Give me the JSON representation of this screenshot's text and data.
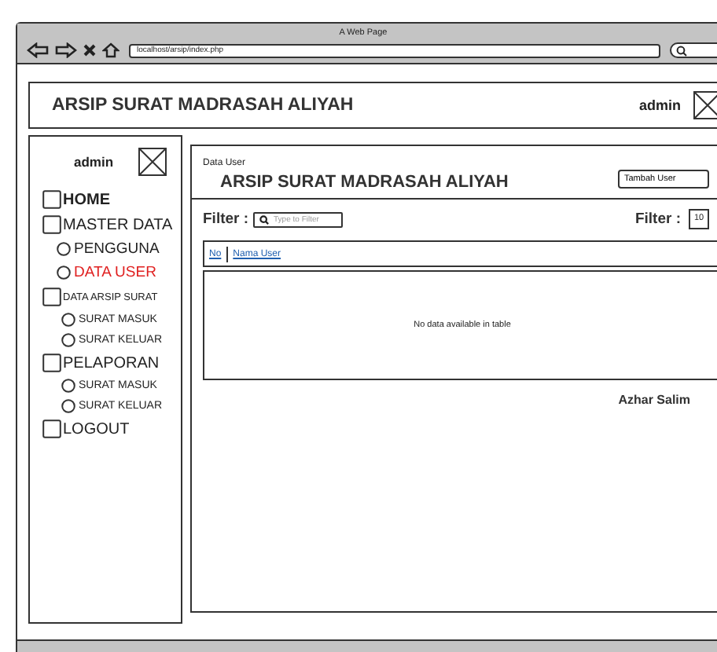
{
  "browser": {
    "title": "A Web Page",
    "url": "localhost/arsip/index.php"
  },
  "header": {
    "title": "ARSIP SURAT MADRASAH ALIYAH",
    "user": "admin"
  },
  "sidebar": {
    "user": "admin",
    "items": [
      {
        "label": "HOME",
        "kind": "square",
        "selected": false
      },
      {
        "label": "MASTER DATA",
        "kind": "square",
        "selected": false,
        "children": [
          {
            "label": "PENGGUNA",
            "kind": "circle",
            "selected": false
          },
          {
            "label": "DATA USER",
            "kind": "circle",
            "selected": true
          }
        ]
      },
      {
        "label": "DATA ARSIP SURAT",
        "kind": "square",
        "selected": false,
        "children": [
          {
            "label": "SURAT MASUK",
            "kind": "circle",
            "selected": false
          },
          {
            "label": "SURAT KELUAR",
            "kind": "circle",
            "selected": false
          }
        ]
      },
      {
        "label": "PELAPORAN",
        "kind": "square",
        "selected": false,
        "children": [
          {
            "label": "SURAT MASUK",
            "kind": "circle",
            "selected": false
          },
          {
            "label": "SURAT KELUAR",
            "kind": "circle",
            "selected": false
          }
        ]
      },
      {
        "label": "LOGOUT",
        "kind": "square",
        "selected": false
      }
    ]
  },
  "main": {
    "breadcrumb": "Data User",
    "title": "ARSIP SURAT MADRASAH ALIYAH",
    "add_button": "Tambah User",
    "filter_label": "Filter :",
    "filter_placeholder": "Type to Filter",
    "length_label": "Filter :",
    "length_value": "10",
    "table": {
      "columns": [
        "No",
        "Nama User"
      ],
      "empty": "No data available in table"
    },
    "footer": "Azhar Salim"
  }
}
